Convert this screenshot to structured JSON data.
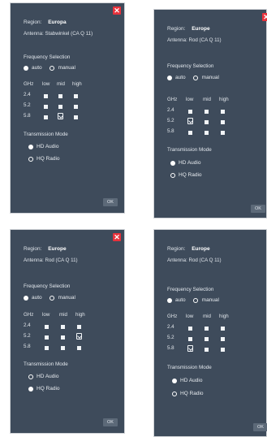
{
  "panels": [
    {
      "region_label": "Region:",
      "region_value": "Europa",
      "antenna": "Antenna: Stabwinkel (CA Q 11)",
      "frequency_title": "Frequency Selection",
      "freq_auto": "auto",
      "freq_manual": "manual",
      "freq_selected": "auto",
      "ghz": "GHz",
      "cols": [
        "low",
        "mid",
        "high"
      ],
      "rows": [
        "2.4",
        "5.2",
        "5.8"
      ],
      "pick_row": 2,
      "pick_col": 1,
      "transmission_title": "Transmission Mode",
      "tm_hd": "HD Audio",
      "tm_hq": "HQ Radio",
      "tm_selected": "hd",
      "ok": "OK"
    },
    {
      "region_label": "Region:",
      "region_value": "Europe",
      "antenna": "Antenna: Rod (CA Q 11)",
      "frequency_title": "Frequency Selection",
      "freq_auto": "auto",
      "freq_manual": "manual",
      "freq_selected": "auto",
      "ghz": "GHz",
      "cols": [
        "low",
        "mid",
        "high"
      ],
      "rows": [
        "2.4",
        "5.2",
        "5.8"
      ],
      "pick_row": 1,
      "pick_col": 0,
      "transmission_title": "Transmission Mode",
      "tm_hd": "HD Audio",
      "tm_hq": "HQ Radio",
      "tm_selected": "hd",
      "ok": "OK"
    },
    {
      "region_label": "Region:",
      "region_value": "Europe",
      "antenna": "Antenna: Rod (CA Q 11)",
      "frequency_title": "Frequency Selection",
      "freq_auto": "auto",
      "freq_manual": "manual",
      "freq_selected": "auto",
      "ghz": "GHz",
      "cols": [
        "low",
        "mid",
        "high"
      ],
      "rows": [
        "2.4",
        "5.2",
        "5.8"
      ],
      "pick_row": 1,
      "pick_col": 2,
      "transmission_title": "Transmission Mode",
      "tm_hd": "HD Audio",
      "tm_hq": "HQ Radio",
      "tm_selected": "hq",
      "ok": "OK"
    },
    {
      "region_label": "Region:",
      "region_value": "Europe",
      "antenna": "Antenna: Rod (CA Q 11)",
      "frequency_title": "Frequency Selection",
      "freq_auto": "auto",
      "freq_manual": "manual",
      "freq_selected": "auto",
      "ghz": "GHz",
      "cols": [
        "low",
        "mid",
        "high"
      ],
      "rows": [
        "2.4",
        "5.2",
        "5.8"
      ],
      "pick_row": 2,
      "pick_col": 0,
      "transmission_title": "Transmission Mode",
      "tm_hd": "HD Audio",
      "tm_hq": "HQ Radio",
      "tm_selected": "hd",
      "ok": "OK"
    }
  ],
  "colors": {
    "panel_bg": "#3e4b5b",
    "close_bg": "#e8323c",
    "text": "#e8ecf0"
  },
  "icons": {
    "close": "close-icon",
    "pick": "hand-pointer-icon"
  }
}
